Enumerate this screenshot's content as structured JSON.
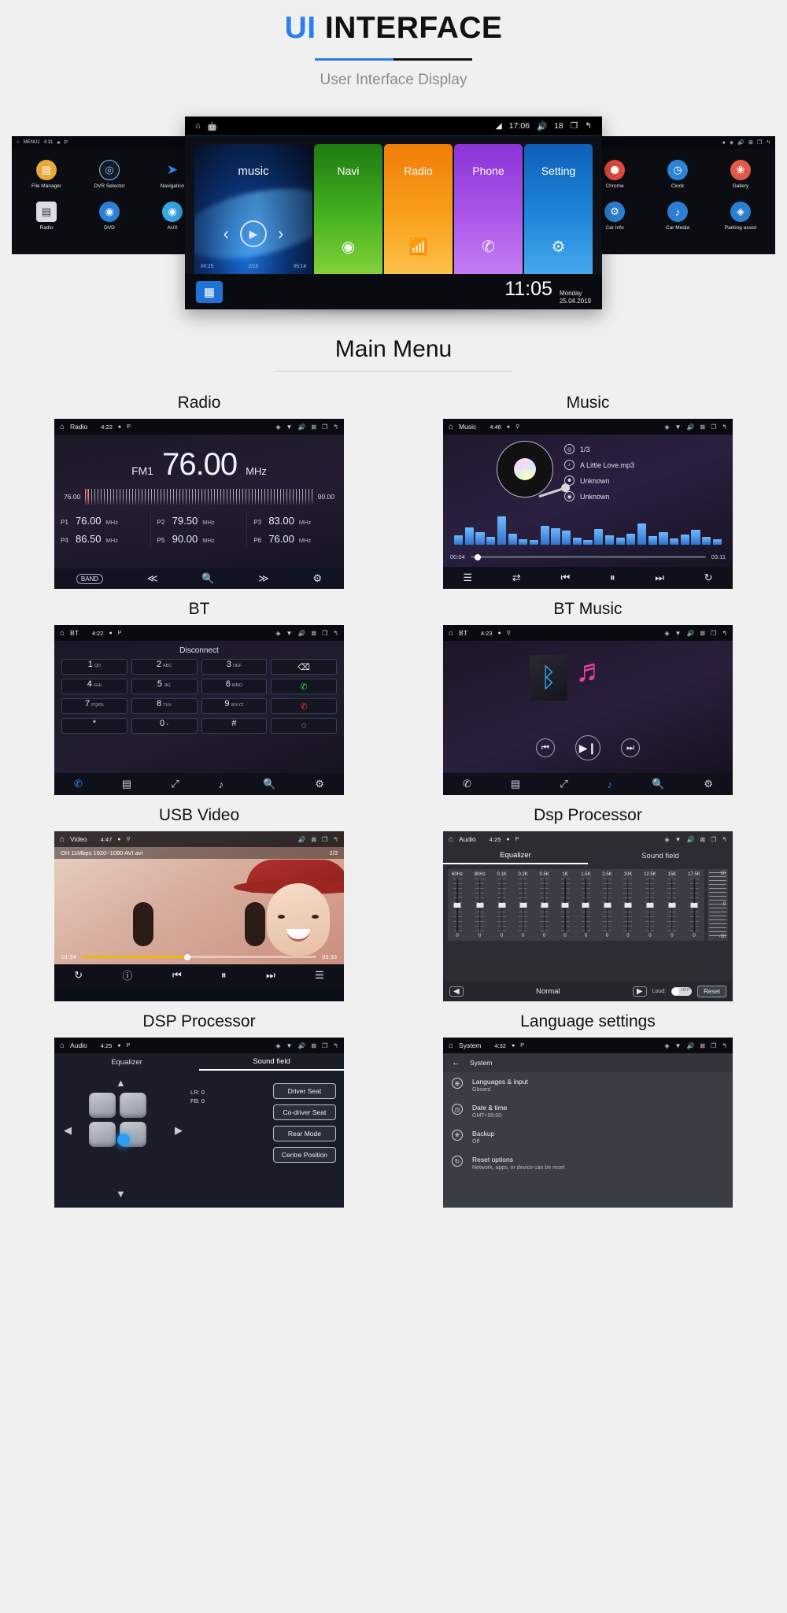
{
  "header": {
    "title_accent": "UI",
    "title_rest": " INTERFACE",
    "subtitle": "User Interface Display"
  },
  "hero": {
    "left_device": {
      "statusbar": {
        "home": "home-icon",
        "menu_label": "MENU1",
        "time": "4:31",
        "dot": "●",
        "park": "P"
      },
      "apps": [
        {
          "label": "File Manager",
          "icon": "folder-icon",
          "color": "#e8a93a"
        },
        {
          "label": "DVR Selector",
          "icon": "camera-icon",
          "color": "#1f2330"
        },
        {
          "label": "Navigation",
          "icon": "nav-arrow-icon",
          "color": "#1f2330"
        },
        {
          "label": "Radio",
          "icon": "radio-icon",
          "color": "#d8dde6"
        },
        {
          "label": "DVD",
          "icon": "disc-icon",
          "color": "#2a7fd6"
        },
        {
          "label": "AUX",
          "icon": "aux-icon",
          "color": "#39a8e8"
        }
      ]
    },
    "center_device": {
      "statusbar": {
        "home": "home-icon",
        "android": "android-icon",
        "signal": "signal-icon",
        "time": "17:06",
        "volume": "volume-icon",
        "volume_level": "18",
        "recents": "recents-icon",
        "back": "back-icon"
      },
      "music_tile": {
        "label": "music",
        "time_current": "00:25",
        "track_pos": "2/15",
        "time_total": "05:14"
      },
      "tiles": [
        {
          "label": "Navi",
          "icon": "location-pin-icon",
          "class": "t-navi"
        },
        {
          "label": "Radio",
          "icon": "radio-tower-icon",
          "class": "t-radio"
        },
        {
          "label": "Phone",
          "icon": "phone-icon",
          "class": "t-phone"
        },
        {
          "label": "Setting",
          "icon": "gear-icon",
          "class": "t-set"
        }
      ],
      "footer": {
        "apps_icon": "apps-grid-icon",
        "clock": "11:05",
        "day": "Monday",
        "date": "25.04.2019"
      }
    },
    "right_device": {
      "statusbar": {
        "dot": "●",
        "location": "◈",
        "volume": "volume-icon",
        "close": "close-icon",
        "recents": "recents-icon",
        "back": "back-icon"
      },
      "apps": [
        {
          "label": "Chrome",
          "icon": "chrome-icon",
          "color": "#e04a3a"
        },
        {
          "label": "Clock",
          "icon": "clock-icon",
          "color": "#2a84d8"
        },
        {
          "label": "Gallery",
          "icon": "gallery-icon",
          "color": "#e0594a"
        },
        {
          "label": "Car Info",
          "icon": "car-info-icon",
          "color": "#2b7fd0"
        },
        {
          "label": "Car Media",
          "icon": "car-media-icon",
          "color": "#2b7fd0"
        },
        {
          "label": "Parking assist",
          "icon": "parking-icon",
          "color": "#2b7fd0"
        }
      ]
    }
  },
  "section": {
    "main_menu_title": "Main Menu"
  },
  "panels": {
    "radio": {
      "title": "Radio",
      "statusbar": {
        "app": "Radio",
        "time": "4:22",
        "dot": "●",
        "park": "P",
        "loc": "◈",
        "wifi": "▼",
        "volume": "volume-icon",
        "close": "close-icon",
        "recents": "recents-icon",
        "back": "back-icon"
      },
      "band": "FM1",
      "frequency": "76.00",
      "unit": "MHz",
      "scale_low": "76.00",
      "scale_high": "90.00",
      "presets": [
        {
          "id": "P1",
          "value": "76.00",
          "unit": "MHz"
        },
        {
          "id": "P2",
          "value": "79.50",
          "unit": "MHz"
        },
        {
          "id": "P3",
          "value": "83.00",
          "unit": "MHz"
        },
        {
          "id": "P4",
          "value": "86.50",
          "unit": "MHz"
        },
        {
          "id": "P5",
          "value": "90.00",
          "unit": "MHz"
        },
        {
          "id": "P6",
          "value": "76.00",
          "unit": "MHz"
        }
      ],
      "toolbar": [
        "BAND",
        "◀◀",
        "search-icon",
        "▶▶",
        "gear-icon"
      ]
    },
    "music": {
      "title": "Music",
      "statusbar": {
        "app": "Music",
        "time": "4:46",
        "dot": "●",
        "usb": "usb-icon",
        "loc": "◈",
        "wifi": "▼",
        "volume": "volume-icon",
        "close": "close-icon",
        "recents": "recents-icon",
        "back": "back-icon"
      },
      "info": [
        {
          "icon": "disc-icon",
          "text": "1/3"
        },
        {
          "icon": "note-icon",
          "text": "A Little Love.mp3"
        },
        {
          "icon": "artist-icon",
          "text": "Unknown"
        },
        {
          "icon": "album-icon",
          "text": "Unknown"
        }
      ],
      "time_current": "00:04",
      "time_total": "03:11",
      "progress_pct": 3,
      "eq_bars": [
        12,
        22,
        16,
        10,
        36,
        14,
        7,
        6,
        24,
        21,
        18,
        9,
        6,
        20,
        12,
        9,
        14,
        27,
        11,
        16,
        8,
        13,
        19,
        10,
        7
      ],
      "toolbar": [
        "playlist-icon",
        "shuffle-icon",
        "previous-icon",
        "pause-icon",
        "next-icon",
        "repeat-icon"
      ]
    },
    "bt": {
      "title": "BT",
      "statusbar": {
        "app": "BT",
        "time": "4:22",
        "dot": "●",
        "park": "P",
        "loc": "◈",
        "wifi": "▼",
        "volume": "volume-icon",
        "close": "close-icon",
        "recents": "recents-icon",
        "back": "back-icon"
      },
      "status": "Disconnect",
      "keys": [
        {
          "n": "1",
          "s": "QD"
        },
        {
          "n": "2",
          "s": "ABC"
        },
        {
          "n": "3",
          "s": "DEF"
        },
        {
          "n": "⌫",
          "s": "",
          "type": "icon"
        },
        {
          "n": "4",
          "s": "GHI"
        },
        {
          "n": "5",
          "s": "JKL"
        },
        {
          "n": "6",
          "s": "MNO"
        },
        {
          "n": "✆",
          "s": "",
          "type": "call"
        },
        {
          "n": "7",
          "s": "PQRS"
        },
        {
          "n": "8",
          "s": "TUV"
        },
        {
          "n": "9",
          "s": "WXYZ"
        },
        {
          "n": "✆",
          "s": "",
          "type": "end"
        },
        {
          "n": "*",
          "s": ""
        },
        {
          "n": "0",
          "s": "+"
        },
        {
          "n": "#",
          "s": ""
        },
        {
          "n": "◌",
          "s": "",
          "type": "icon"
        }
      ],
      "toolbar": [
        "phone-icon",
        "contacts-icon",
        "transfer-icon",
        "music-note-icon",
        "search-icon",
        "gear-icon"
      ]
    },
    "bt_music": {
      "title": "BT Music",
      "statusbar": {
        "app": "BT",
        "time": "4:23",
        "dot": "●",
        "usb": "usb-icon",
        "loc": "◈",
        "wifi": "▼",
        "volume": "volume-icon",
        "close": "close-icon",
        "recents": "recents-icon",
        "back": "back-icon"
      },
      "logo": "bluetooth-icon",
      "controls": [
        "previous-icon",
        "play-pause-icon",
        "next-icon"
      ],
      "toolbar": [
        "phone-icon",
        "contacts-icon",
        "transfer-icon",
        "music-note-icon",
        "search-icon",
        "gear-icon"
      ]
    },
    "usb_video": {
      "title": "USB Video",
      "statusbar": {
        "app": "Video",
        "time": "4:47",
        "dot": "●",
        "usb": "usb-icon",
        "volume": "volume-icon",
        "close": "close-icon",
        "recents": "recents-icon",
        "back": "back-icon"
      },
      "file_info": "OH 11Mbps 1920~1080 AVI.avi",
      "page": "2/3",
      "time_current": "01:34",
      "time_total": "03:33",
      "progress_pct": 45,
      "toolbar": [
        "repeat-icon",
        "info-icon",
        "previous-icon",
        "pause-icon",
        "next-icon",
        "playlist-icon"
      ]
    },
    "dsp_eq": {
      "title": "Dsp Processor",
      "statusbar": {
        "app": "Audio",
        "time": "4:25",
        "dot": "●",
        "park": "P",
        "loc": "◈",
        "wifi": "▼",
        "volume": "volume-icon",
        "close": "close-icon",
        "recents": "recents-icon",
        "back": "back-icon"
      },
      "tabs": [
        {
          "label": "Equalizer",
          "active": true
        },
        {
          "label": "Sound field",
          "active": false
        }
      ],
      "bands": [
        {
          "hz": "60Hz",
          "value": "0"
        },
        {
          "hz": "80Hz",
          "value": "0"
        },
        {
          "hz": "0.1K",
          "value": "0"
        },
        {
          "hz": "0.2K",
          "value": "0"
        },
        {
          "hz": "0.5K",
          "value": "0"
        },
        {
          "hz": "1K",
          "value": "0"
        },
        {
          "hz": "1.5K",
          "value": "0"
        },
        {
          "hz": "2.5K",
          "value": "0"
        },
        {
          "hz": "10K",
          "value": "0"
        },
        {
          "hz": "12.5K",
          "value": "0"
        },
        {
          "hz": "15K",
          "value": "0"
        },
        {
          "hz": "17.5K",
          "value": "0"
        }
      ],
      "ruler": {
        "top": "10",
        "mid": "0",
        "bottom": "-10"
      },
      "footer": {
        "prev": "◀",
        "mode": "Normal",
        "next": "▶",
        "loud_label": "Loud:",
        "toggle_state": "OFF",
        "reset": "Reset"
      }
    },
    "dsp_sf": {
      "title": "DSP Processor",
      "statusbar": {
        "app": "Audio",
        "time": "4:25",
        "dot": "●",
        "park": "P",
        "loc": "◈",
        "wifi": "▼",
        "volume": "volume-icon",
        "close": "close-icon",
        "recents": "recents-icon",
        "back": "back-icon"
      },
      "tabs": [
        {
          "label": "Equalizer",
          "active": false
        },
        {
          "label": "Sound field",
          "active": true
        }
      ],
      "lr_value": "LR: 0",
      "fb_value": "FB: 0",
      "buttons": [
        "Driver Seat",
        "Co-driver Seat",
        "Rear Mode",
        "Centre Position"
      ]
    },
    "language": {
      "title": "Language settings",
      "statusbar": {
        "app": "System",
        "time": "4:32",
        "dot": "●",
        "park": "P",
        "loc": "◈",
        "wifi": "▼",
        "volume": "volume-icon",
        "close": "close-icon",
        "recents": "recents-icon",
        "back": "back-icon"
      },
      "back_label": "System",
      "items": [
        {
          "icon": "globe-icon",
          "title": "Languages & input",
          "sub": "Gboard"
        },
        {
          "icon": "clock-icon",
          "title": "Date & time",
          "sub": "GMT+00:00"
        },
        {
          "icon": "backup-icon",
          "title": "Backup",
          "sub": "Off"
        },
        {
          "icon": "reset-icon",
          "title": "Reset options",
          "sub": "Network, apps, or device can be reset"
        }
      ]
    }
  }
}
